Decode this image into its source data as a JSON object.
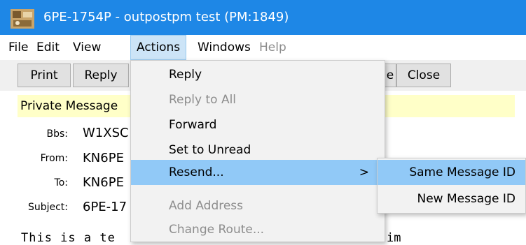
{
  "window": {
    "title": "6PE-1754P - outpostpm test  (PM:1849)",
    "icon": "outpost-app-icon",
    "accent": "#1e87e6"
  },
  "menubar": {
    "items": [
      {
        "label": "File",
        "state": "normal"
      },
      {
        "label": "Edit",
        "state": "normal"
      },
      {
        "label": "View",
        "state": "normal"
      },
      {
        "label": "Actions",
        "state": "open"
      },
      {
        "label": "Windows",
        "state": "normal"
      },
      {
        "label": "Help",
        "state": "disabled"
      }
    ]
  },
  "toolbar": {
    "print_label": "Print",
    "reply_label": "Reply",
    "partial_label": "e",
    "close_label": "Close"
  },
  "message": {
    "private_label": "Private Message",
    "bbs_label": "Bbs:",
    "bbs_value": "W1XSC",
    "from_label": "From:",
    "from_value": "KN6PE",
    "to_label": "To:",
    "to_value": "KN6PE",
    "subject_label": "Subject:",
    "subject_value": "6PE-17",
    "body_visible": "This is a te",
    "body_tail": "im"
  },
  "actions_menu": {
    "items": [
      {
        "label": "Reply",
        "enabled": true
      },
      {
        "label": "Reply to All",
        "enabled": false
      },
      {
        "label": "Forward",
        "enabled": true
      },
      {
        "label": "Set to Unread",
        "enabled": true
      },
      {
        "label": "Resend...",
        "enabled": true,
        "highlighted": true,
        "submenu_arrow": ">"
      },
      {
        "label": "Add Address",
        "enabled": false
      },
      {
        "label": "Change Route...",
        "enabled": false
      }
    ]
  },
  "resend_submenu": {
    "items": [
      {
        "label": "Same Message ID",
        "highlighted": true
      },
      {
        "label": "New Message ID",
        "highlighted": false
      }
    ]
  },
  "colors": {
    "highlight": "#91c9f7",
    "private_bar": "#ffffc8",
    "disabled_text": "#8d8d8d"
  }
}
